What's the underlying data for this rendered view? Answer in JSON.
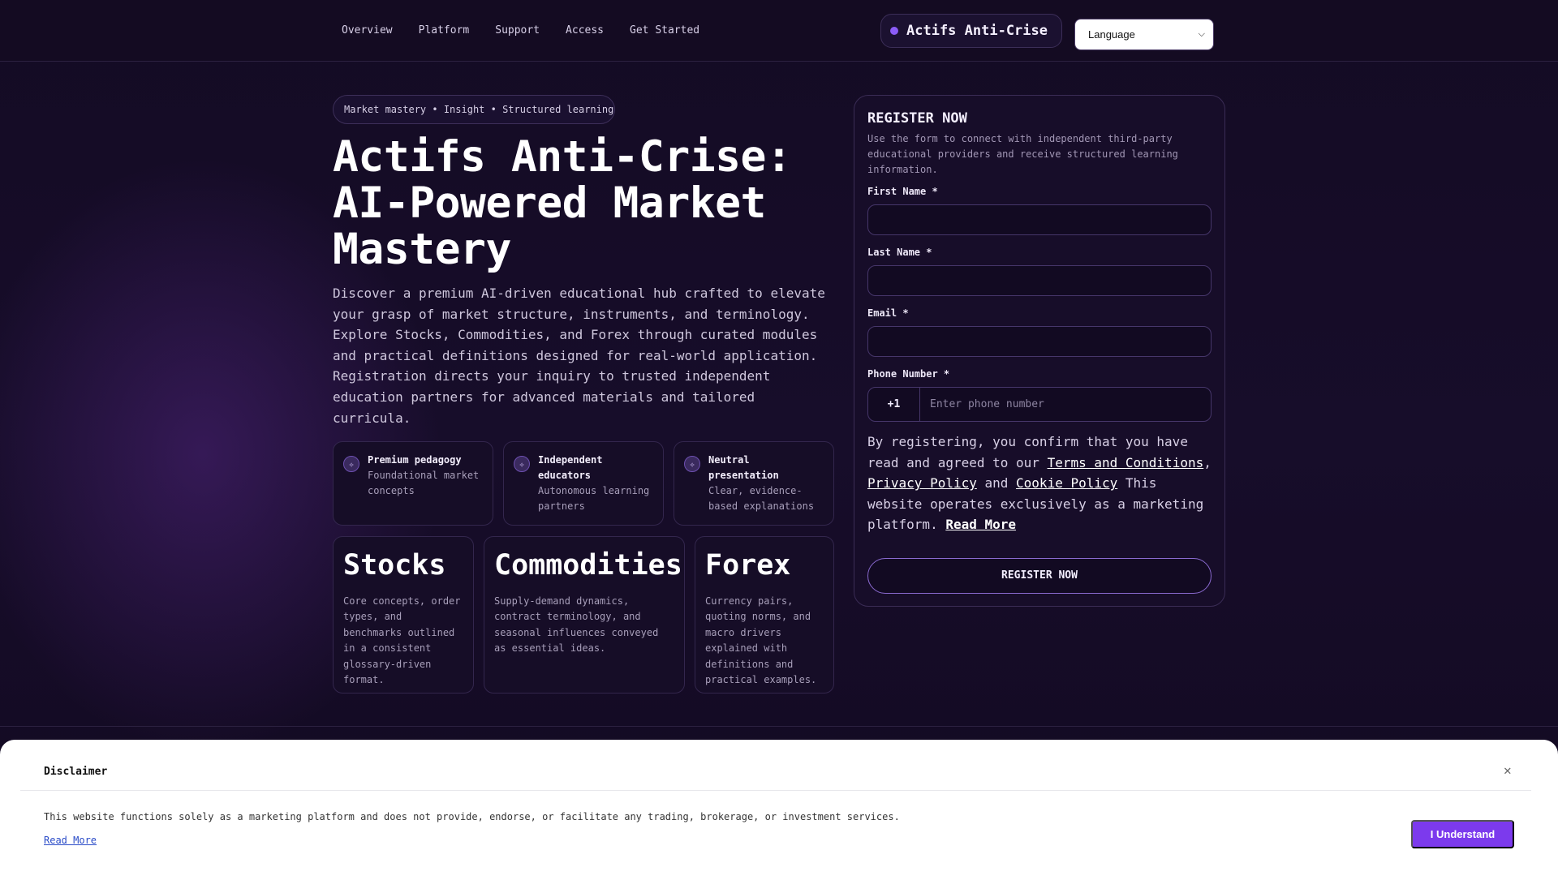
{
  "nav": {
    "items": [
      "Overview",
      "Platform",
      "Support",
      "Access",
      "Get Started"
    ]
  },
  "brand": {
    "name": "Actifs Anti-Crise",
    "accent": "#8b5cf6"
  },
  "language": {
    "selected": "Language"
  },
  "hero": {
    "pill": "Market mastery • Insight • Structured learning",
    "title": "Actifs Anti-Crise: AI-Powered Market Mastery",
    "lead": "Discover a premium AI-driven educational hub crafted to elevate your grasp of market structure, instruments, and terminology. Explore Stocks, Commodities, and Forex through curated modules and practical definitions designed for real-world application. Registration directs your inquiry to trusted independent education partners for advanced materials and tailored curricula."
  },
  "features": [
    {
      "icon": "sparkle-icon",
      "title": "Premium pedagogy",
      "desc": "Foundational market concepts"
    },
    {
      "icon": "sparkle-icon",
      "title": "Independent educators",
      "desc": "Autonomous learning partners"
    },
    {
      "icon": "sparkle-icon",
      "title": "Neutral presentation",
      "desc": "Clear, evidence-based explanations"
    }
  ],
  "categories": [
    {
      "title": "Stocks",
      "desc": "Core concepts, order types, and benchmarks outlined in a consistent glossary-driven format."
    },
    {
      "title": "Commodities",
      "desc": "Supply-demand dynamics, contract terminology, and seasonal influences conveyed as essential ideas."
    },
    {
      "title": "Forex",
      "desc": "Currency pairs, quoting norms, and macro drivers explained with definitions and practical examples."
    }
  ],
  "form": {
    "title": "REGISTER NOW",
    "subtitle": "Use the form to connect with independent third-party educational providers and receive structured learning information.",
    "first_name_label": "First Name *",
    "last_name_label": "Last Name *",
    "email_label": "Email *",
    "phone_label": "Phone Number *",
    "phone_code": "+1",
    "phone_placeholder": "Enter phone number",
    "consent_prefix": "By registering, you confirm that you have read and agreed to our ",
    "terms_link": "Terms and Conditions",
    "comma": ", ",
    "privacy_link": "Privacy Policy",
    "and": " and ",
    "cookie_link": "Cookie Policy",
    "consent_suffix": " This website operates exclusively as a marketing platform. ",
    "read_more": "Read More",
    "submit": "REGISTER NOW"
  },
  "disclaimer": {
    "title": "Disclaimer",
    "close_icon": "close-icon",
    "text": "This website functions solely as a marketing platform and does not provide, endorse, or facilitate any trading, brokerage, or investment services.",
    "read_more": "Read More",
    "button": "I Understand",
    "button_color": "#7c3aed"
  }
}
